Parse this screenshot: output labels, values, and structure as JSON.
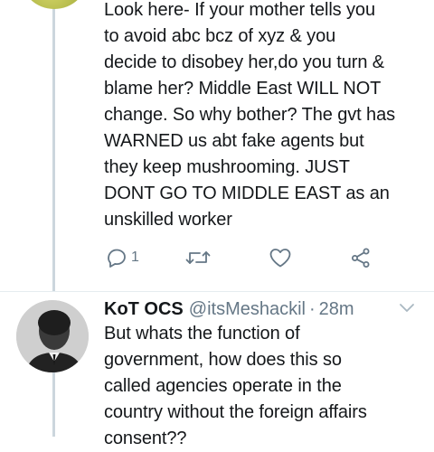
{
  "tweet_1": {
    "lines": [
      "Look here- If your mother tells you",
      "to avoid abc bcz of xyz & you",
      "decide to disobey her,do you turn &",
      "blame her? Middle East WILL NOT",
      "change. So why bother? The gvt has",
      "WARNED us abt fake agents but",
      "they keep mushrooming. JUST",
      "DONT GO TO MIDDLE EAST as an",
      "unskilled worker"
    ],
    "actions": {
      "reply_count": "1",
      "reply_icon": "reply-icon",
      "retweet_icon": "retweet-icon",
      "like_icon": "heart-icon",
      "share_icon": "share-icon"
    }
  },
  "tweet_2": {
    "name": "KoT OCS",
    "handle": "@itsMeshackil",
    "separator": "·",
    "time": "28m",
    "lines": [
      "But whats the function of",
      "government, how does this so",
      "called agencies operate in the",
      "country without the foreign affairs",
      "consent??"
    ]
  },
  "colors": {
    "text": "#14171a",
    "secondary": "#657786",
    "thread_line": "#ccd6dd"
  }
}
